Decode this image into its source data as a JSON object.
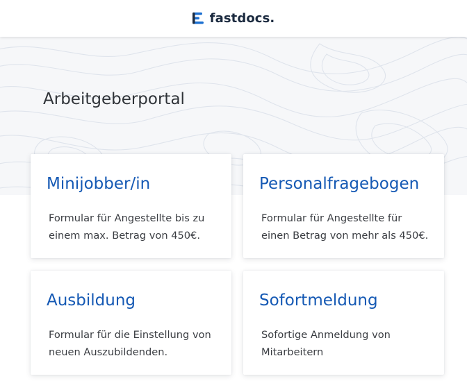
{
  "header": {
    "logo_text": "fastdocs.",
    "logo_icon": "fastdocs-logo-icon"
  },
  "colors": {
    "brand_blue": "#1559b4",
    "logo_dark": "#1b2a3f",
    "hero_background": "#f6f7f9"
  },
  "page": {
    "title": "Arbeitgeberportal"
  },
  "cards": [
    {
      "title": "Minijobber/in",
      "description": "Formular für Angestellte bis zu einem max. Betrag von 450€."
    },
    {
      "title": "Personalfragebogen",
      "description": "Formular für Angestellte für einen Betrag von mehr als 450€."
    },
    {
      "title": "Ausbildung",
      "description": "Formular für die Einstellung von neuen Auszubildenden."
    },
    {
      "title": "Sofortmeldung",
      "description": "Sofortige Anmeldung von Mitarbeitern"
    }
  ]
}
